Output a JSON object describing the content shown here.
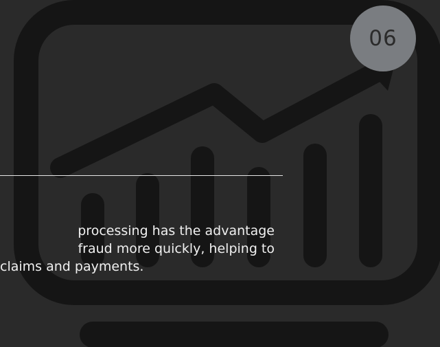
{
  "badge": {
    "number": "06"
  },
  "body": {
    "lines": [
      "processing has the advantage",
      "fraud more quickly, helping to",
      "claims and payments."
    ]
  },
  "colors": {
    "background": "#2a2a2a",
    "illustration": "#151515",
    "badge": "#7a7d81",
    "text": "#f0f0f0",
    "divider": "#e6e6e6"
  },
  "icons": {
    "illustration": "monitor-growth-chart-icon"
  }
}
